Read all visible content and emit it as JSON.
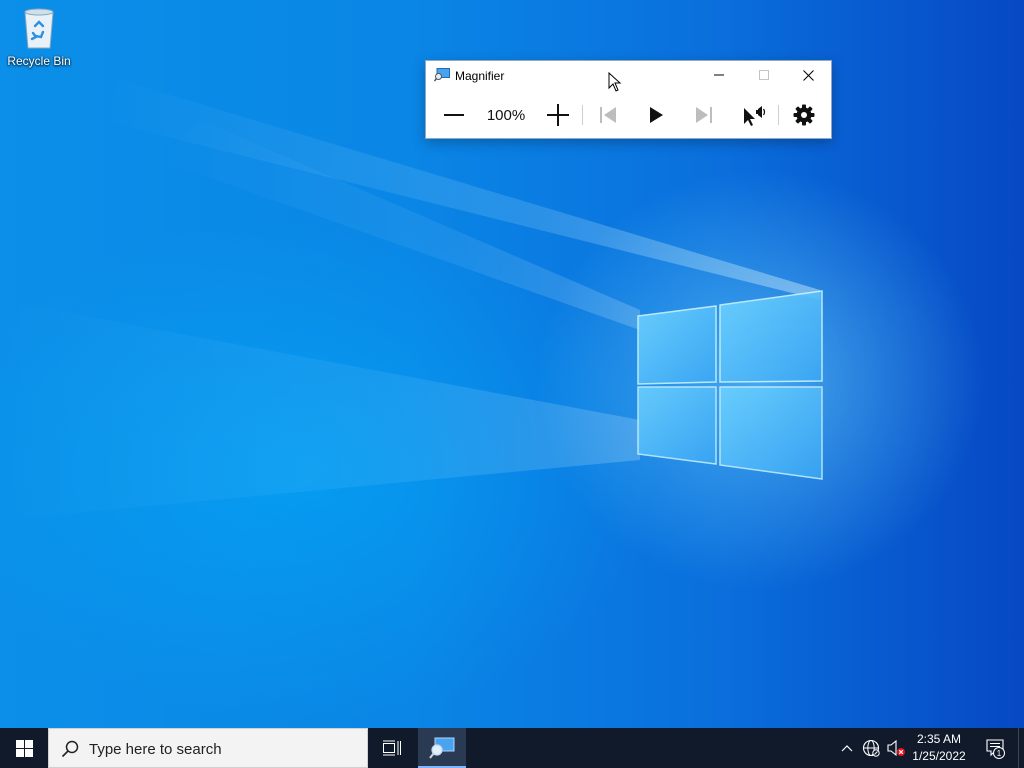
{
  "desktop": {
    "icons": [
      {
        "label": "Recycle Bin",
        "icon": "recycle-bin-icon"
      }
    ]
  },
  "magnifier": {
    "title": "Magnifier",
    "zoom_level": "100%",
    "toolbar": {
      "zoom_out": "zoom-out-icon",
      "zoom_in": "zoom-in-icon",
      "previous": "previous-icon",
      "play": "play-icon",
      "next": "next-icon",
      "read_from_here": "read-from-here-icon",
      "settings": "gear-icon"
    }
  },
  "taskbar": {
    "search_placeholder": "Type here to search",
    "apps": [
      {
        "name": "Magnifier",
        "active": true,
        "icon": "magnifier-app-icon"
      }
    ],
    "clock": {
      "time": "2:35 AM",
      "date": "1/25/2022"
    },
    "notifications_count": "1",
    "accent": "#7fb4ff"
  }
}
